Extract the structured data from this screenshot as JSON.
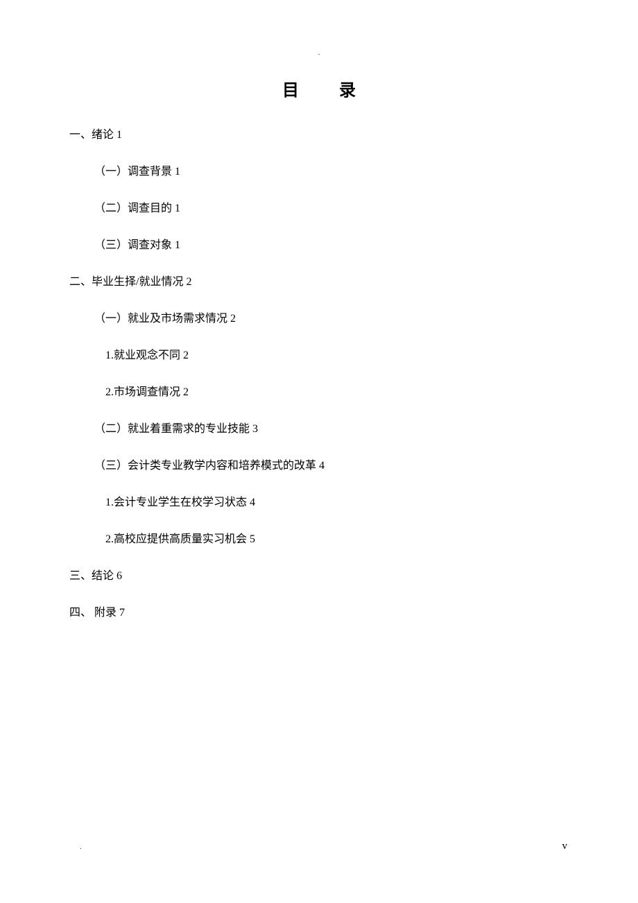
{
  "header_mark": ".",
  "footer_left_mark": ".",
  "footer_right_num": "v",
  "title_char1": "目",
  "title_char2": "录",
  "entries": [
    {
      "level": 1,
      "text": "一、绪论",
      "page": "1"
    },
    {
      "level": 2,
      "text": "（一）调查背景",
      "page": "1"
    },
    {
      "level": 2,
      "text": "（二）调查目的",
      "page": "1"
    },
    {
      "level": 2,
      "text": "（三）调查对象",
      "page": "1"
    },
    {
      "level": 1,
      "text": "二、毕业生择/就业情况",
      "page": "2"
    },
    {
      "level": 2,
      "text": "（一）就业及市场需求情况",
      "page": "2"
    },
    {
      "level": 3,
      "text": "1.就业观念不同",
      "page": "2"
    },
    {
      "level": 3,
      "text": "2.市场调查情况",
      "page": "2"
    },
    {
      "level": 2,
      "text": "（二）就业着重需求的专业技能",
      "page": "3"
    },
    {
      "level": 2,
      "text": "（三）会计类专业教学内容和培养模式的改革",
      "page": "4"
    },
    {
      "level": 3,
      "text": "1.会计专业学生在校学习状态",
      "page": "4"
    },
    {
      "level": 3,
      "text": "2.高校应提供高质量实习机会",
      "page": "5"
    },
    {
      "level": 1,
      "text": "三、结论",
      "page": "6"
    },
    {
      "level": 1,
      "text": "四、 附录",
      "page": "7"
    }
  ]
}
